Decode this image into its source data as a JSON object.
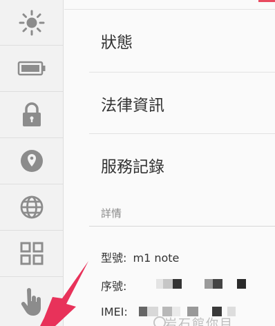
{
  "sidebar": {
    "items": [
      {
        "icon": "brightness-icon"
      },
      {
        "icon": "battery-icon"
      },
      {
        "icon": "lock-icon"
      },
      {
        "icon": "location-icon"
      },
      {
        "icon": "globe-icon"
      },
      {
        "icon": "apps-grid-icon"
      },
      {
        "icon": "hand-gesture-icon"
      }
    ]
  },
  "menu": {
    "status": "狀態",
    "legal": "法律資訊",
    "service": "服務記錄"
  },
  "details": {
    "header": "詳情",
    "model_label": "型號:",
    "model_value": "m1 note",
    "serial_label": "序號:",
    "imei_label": "IMEI:"
  },
  "watermark": "岩石館你目",
  "colors": {
    "icon_gray": "#8c8c8c",
    "accent_pink": "#e8325a",
    "divider": "#e2e2e2"
  }
}
